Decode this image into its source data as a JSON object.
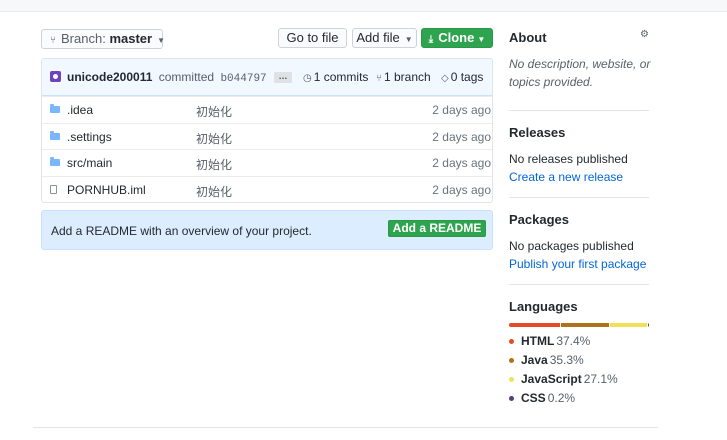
{
  "toolbar": {
    "branch_label": "Branch:",
    "branch_value": "master",
    "go_to_file": "Go to file",
    "add_file": "Add file",
    "clone": "Clone",
    "branch_icon": "git-branch-icon",
    "download_icon": "download-icon"
  },
  "commit": {
    "user": "unicode200011",
    "action": "committed",
    "sha": "b044797 ...",
    "ellipsis": "…",
    "commits": "1 commits",
    "branches": "1 branch",
    "tags": "0 tags",
    "avatar_color": "#6f42c1"
  },
  "files": [
    {
      "name": ".idea",
      "message": "初始化",
      "age": "2 days ago",
      "icon": "folder-icon"
    },
    {
      "name": ".settings",
      "message": "初始化",
      "age": "2 days ago",
      "icon": "folder-icon"
    },
    {
      "name": "src/main",
      "message": "初始化",
      "age": "2 days ago",
      "icon": "folder-icon"
    },
    {
      "name": "PORNHUB.iml",
      "message": "初始化",
      "age": "2 days ago",
      "icon": "file-icon"
    }
  ],
  "readme": {
    "prompt": "Add a README with an overview of your project.",
    "button": "Add a README"
  },
  "sidebar": {
    "about": {
      "heading": "About",
      "line1": "No description, website, or",
      "line2": "topics provided."
    },
    "releases": {
      "heading": "Releases",
      "status": "No releases published",
      "link": "Create a new release"
    },
    "packages": {
      "heading": "Packages",
      "status": "No packages published",
      "link": "Publish your first package"
    },
    "languages": {
      "heading": "Languages",
      "items": [
        {
          "name": "HTML",
          "percent": "37.4%",
          "value": 37.4,
          "color": "#e34c26"
        },
        {
          "name": "Java",
          "percent": "35.3%",
          "value": 35.3,
          "color": "#b07219"
        },
        {
          "name": "JavaScript",
          "percent": "27.1%",
          "value": 27.1,
          "color": "#f1e05a"
        },
        {
          "name": "CSS",
          "percent": "0.2%",
          "value": 0.2,
          "color": "#563d7c"
        }
      ]
    }
  },
  "colors": {
    "accent_green": "#2ea44f",
    "link_blue": "#0366d6",
    "commit_bar_bg": "#f1f8ff",
    "readme_bg": "#dbedff"
  }
}
